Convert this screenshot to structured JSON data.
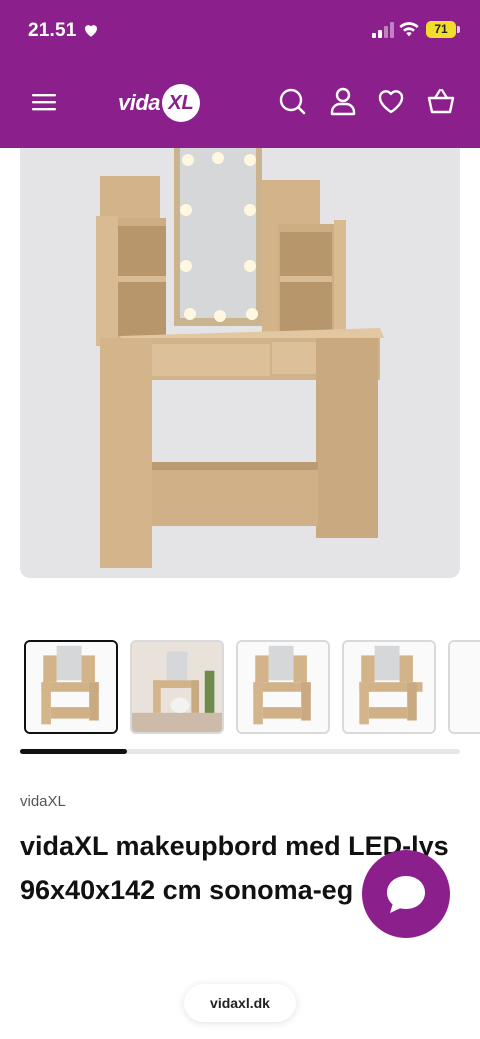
{
  "status_bar": {
    "time": "21.51",
    "battery": "71"
  },
  "header": {
    "logo_text": "vida",
    "logo_badge": "XL",
    "icons": [
      "menu-icon",
      "search-icon",
      "account-icon",
      "heart-icon",
      "basket-icon"
    ],
    "brand_color": "#8b1f8b"
  },
  "product": {
    "brand": "vidaXL",
    "title": "vidaXL makeupbord med LED-lys 96x40x142 cm sonoma-eg",
    "thumbnail_count": 5,
    "active_thumbnail": 1
  },
  "browser": {
    "url": "vidaxl.dk"
  },
  "colors": {
    "wood": "#d7b98e",
    "accent": "#8b1f8b"
  }
}
